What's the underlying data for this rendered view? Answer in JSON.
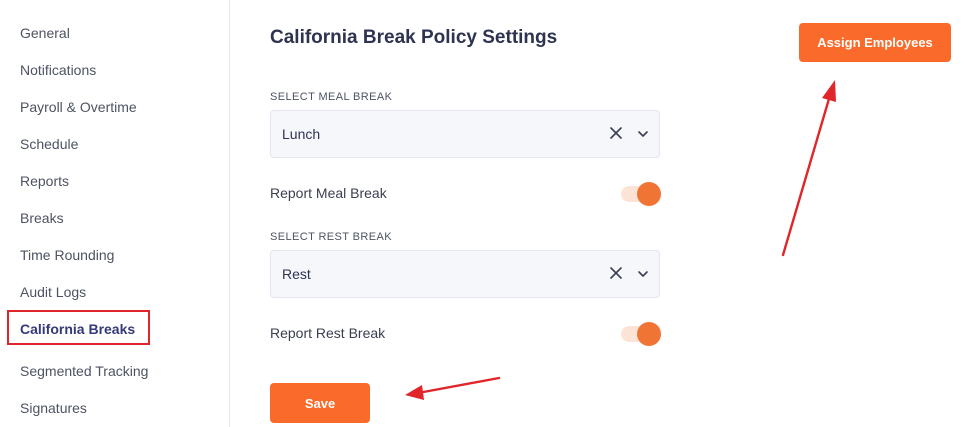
{
  "sidebar": {
    "items": [
      {
        "label": "General"
      },
      {
        "label": "Notifications"
      },
      {
        "label": "Payroll & Overtime"
      },
      {
        "label": "Schedule"
      },
      {
        "label": "Reports"
      },
      {
        "label": "Breaks"
      },
      {
        "label": "Time Rounding"
      },
      {
        "label": "Audit Logs"
      },
      {
        "label": "California Breaks"
      },
      {
        "label": "Segmented Tracking"
      },
      {
        "label": "Signatures"
      }
    ],
    "active_index": 8
  },
  "page": {
    "title": "California Break Policy Settings",
    "assign_button": "Assign Employees",
    "save_button": "Save"
  },
  "meal_break": {
    "label": "SELECT MEAL BREAK",
    "value": "Lunch",
    "toggle_label": "Report Meal Break",
    "toggle_on": true
  },
  "rest_break": {
    "label": "SELECT REST BREAK",
    "value": "Rest",
    "toggle_label": "Report Rest Break",
    "toggle_on": true
  },
  "colors": {
    "accent": "#fa6a2a",
    "toggle_knob": "#f07433",
    "annotation": "#e0262a",
    "active_nav": "#343a78"
  },
  "icons": {
    "clear": "close-icon",
    "dropdown": "chevron-down-icon"
  }
}
